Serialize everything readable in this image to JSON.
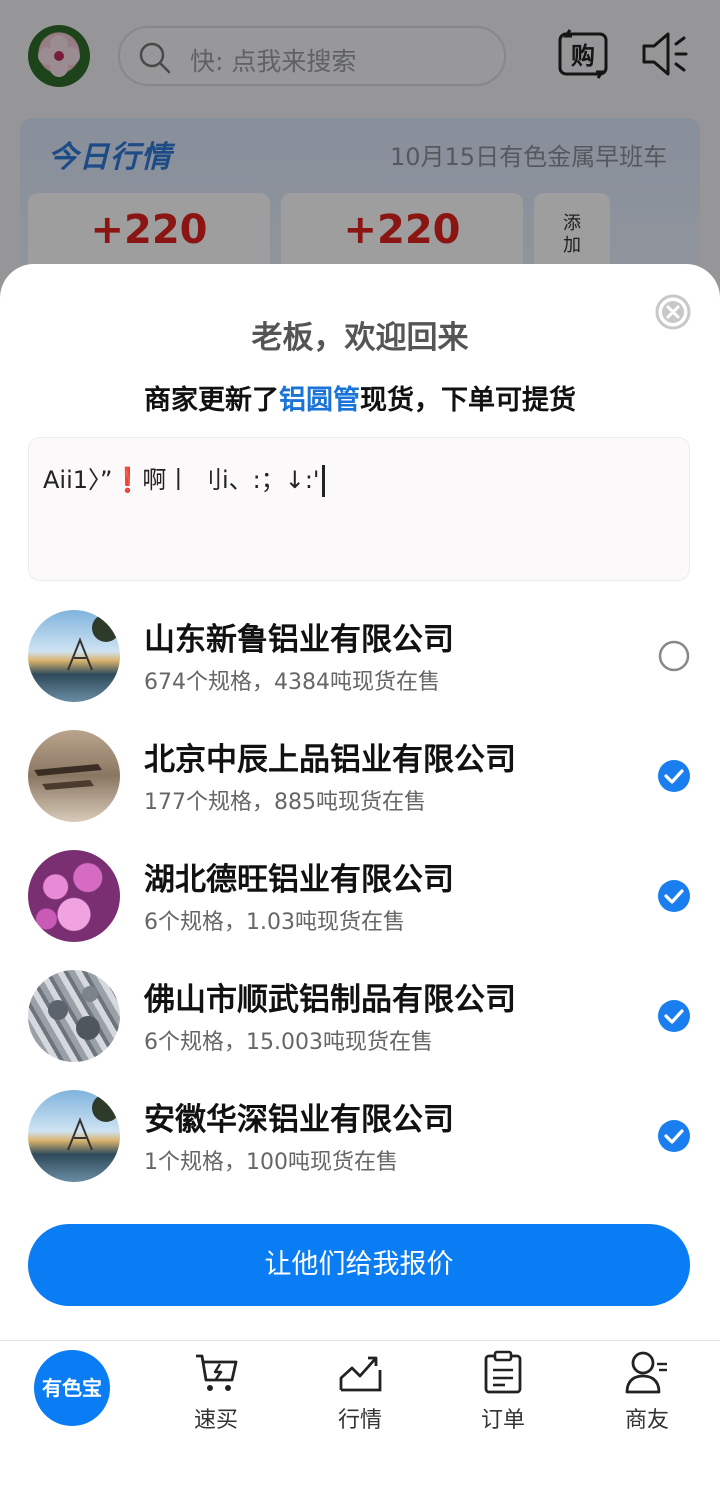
{
  "header": {
    "search_placeholder": "快: 点我来搜索",
    "buy_icon_label": "购"
  },
  "market": {
    "title": "今日行情",
    "subtitle": "10月15日有色金属早班车",
    "prices": [
      "+220",
      "+220"
    ],
    "add_label": "添加"
  },
  "sheet": {
    "title": "老板，欢迎回来",
    "subtitle_prefix": "商家更新了",
    "subtitle_highlight": "铝圆管",
    "subtitle_suffix": "现货，下单可提货",
    "note_text": "Aii1〉”❗啊丨 刂i、:；↓:'",
    "merchants": [
      {
        "name": "山东新鲁铝业有限公司",
        "info": "674个规格，4384吨现货在售",
        "selected": false
      },
      {
        "name": "北京中辰上品铝业有限公司",
        "info": "177个规格，885吨现货在售",
        "selected": true
      },
      {
        "name": "湖北德旺铝业有限公司",
        "info": "6个规格，1.03吨现货在售",
        "selected": true
      },
      {
        "name": "佛山市顺武铝制品有限公司",
        "info": "6个规格，15.003吨现货在售",
        "selected": true
      },
      {
        "name": "安徽华深铝业有限公司",
        "info": "1个规格，100吨现货在售",
        "selected": true
      }
    ],
    "submit_label": "让他们给我报价"
  },
  "nav": {
    "home_label": "有色宝",
    "items": [
      {
        "label": "速买",
        "icon": "cart-icon"
      },
      {
        "label": "行情",
        "icon": "trend-chart-icon"
      },
      {
        "label": "订单",
        "icon": "clipboard-icon"
      },
      {
        "label": "商友",
        "icon": "contacts-icon"
      }
    ]
  },
  "colors": {
    "accent": "#0a7cf4",
    "highlight": "#1a73d9",
    "price_red": "#e0221e",
    "check_blue": "#1a7ef0"
  }
}
